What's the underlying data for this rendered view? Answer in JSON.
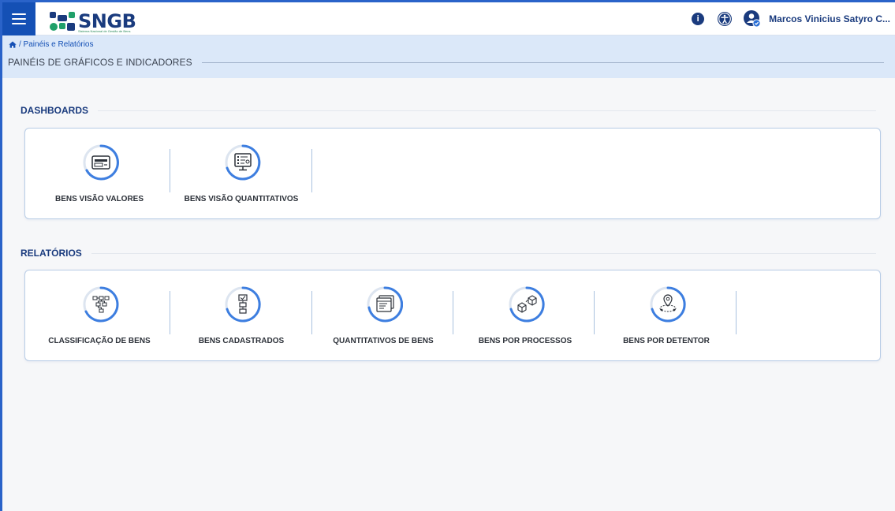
{
  "header": {
    "menu_icon": "hamburger-menu-icon",
    "logo_text": "SNGB",
    "logo_subtitle": "Sistema Nacional de Gestão de Bens",
    "info_icon": "info-icon",
    "accessibility_icon": "accessibility-icon",
    "user_icon": "user-verified-icon",
    "user_name": "Marcos Vinicius Satyro C...",
    "brand_color": "#1450b5"
  },
  "breadcrumb": {
    "home_icon": "home-icon",
    "path": "/ Painéis e Relatórios"
  },
  "page": {
    "title": "PAINÉIS DE GRÁFICOS E INDICADORES"
  },
  "dashboards": {
    "heading": "DASHBOARDS",
    "items": [
      {
        "label": "BENS VISÃO VALORES",
        "icon": "card-payment-icon"
      },
      {
        "label": "BENS VISÃO QUANTITATIVOS",
        "icon": "monitor-checklist-icon"
      }
    ]
  },
  "relatorios": {
    "heading": "RELATÓRIOS",
    "items": [
      {
        "label": "CLASSIFICAÇÃO DE BENS",
        "icon": "hierarchy-tree-icon"
      },
      {
        "label": "BENS CADASTRADOS",
        "icon": "flowchart-icon"
      },
      {
        "label": "QUANTITATIVOS DE BENS",
        "icon": "document-list-icon"
      },
      {
        "label": "BENS POR PROCESSOS",
        "icon": "boxes-icon"
      },
      {
        "label": "BENS POR DETENTOR",
        "icon": "location-pin-icon"
      }
    ]
  }
}
